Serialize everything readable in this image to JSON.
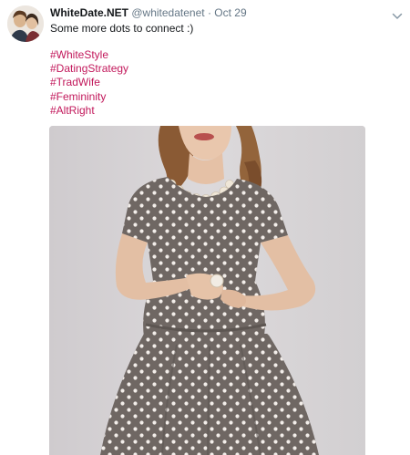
{
  "tweet": {
    "display_name": "WhiteDate.NET",
    "handle": "@whitedatenet",
    "separator": "·",
    "timestamp": "Oct 29",
    "text": "Some more dots to connect :)",
    "hashtags": [
      "#WhiteStyle",
      "#DatingStrategy",
      "#TradWife",
      "#Femininity",
      "#AltRight"
    ],
    "icons": {
      "avatar": "profile-photo",
      "menu": "chevron-down-icon"
    },
    "colors": {
      "name": "#14171a",
      "muted": "#657786",
      "hashtag": "#c2185b",
      "photo_background": "#d4d1d3",
      "dress": "#6f6763"
    }
  }
}
